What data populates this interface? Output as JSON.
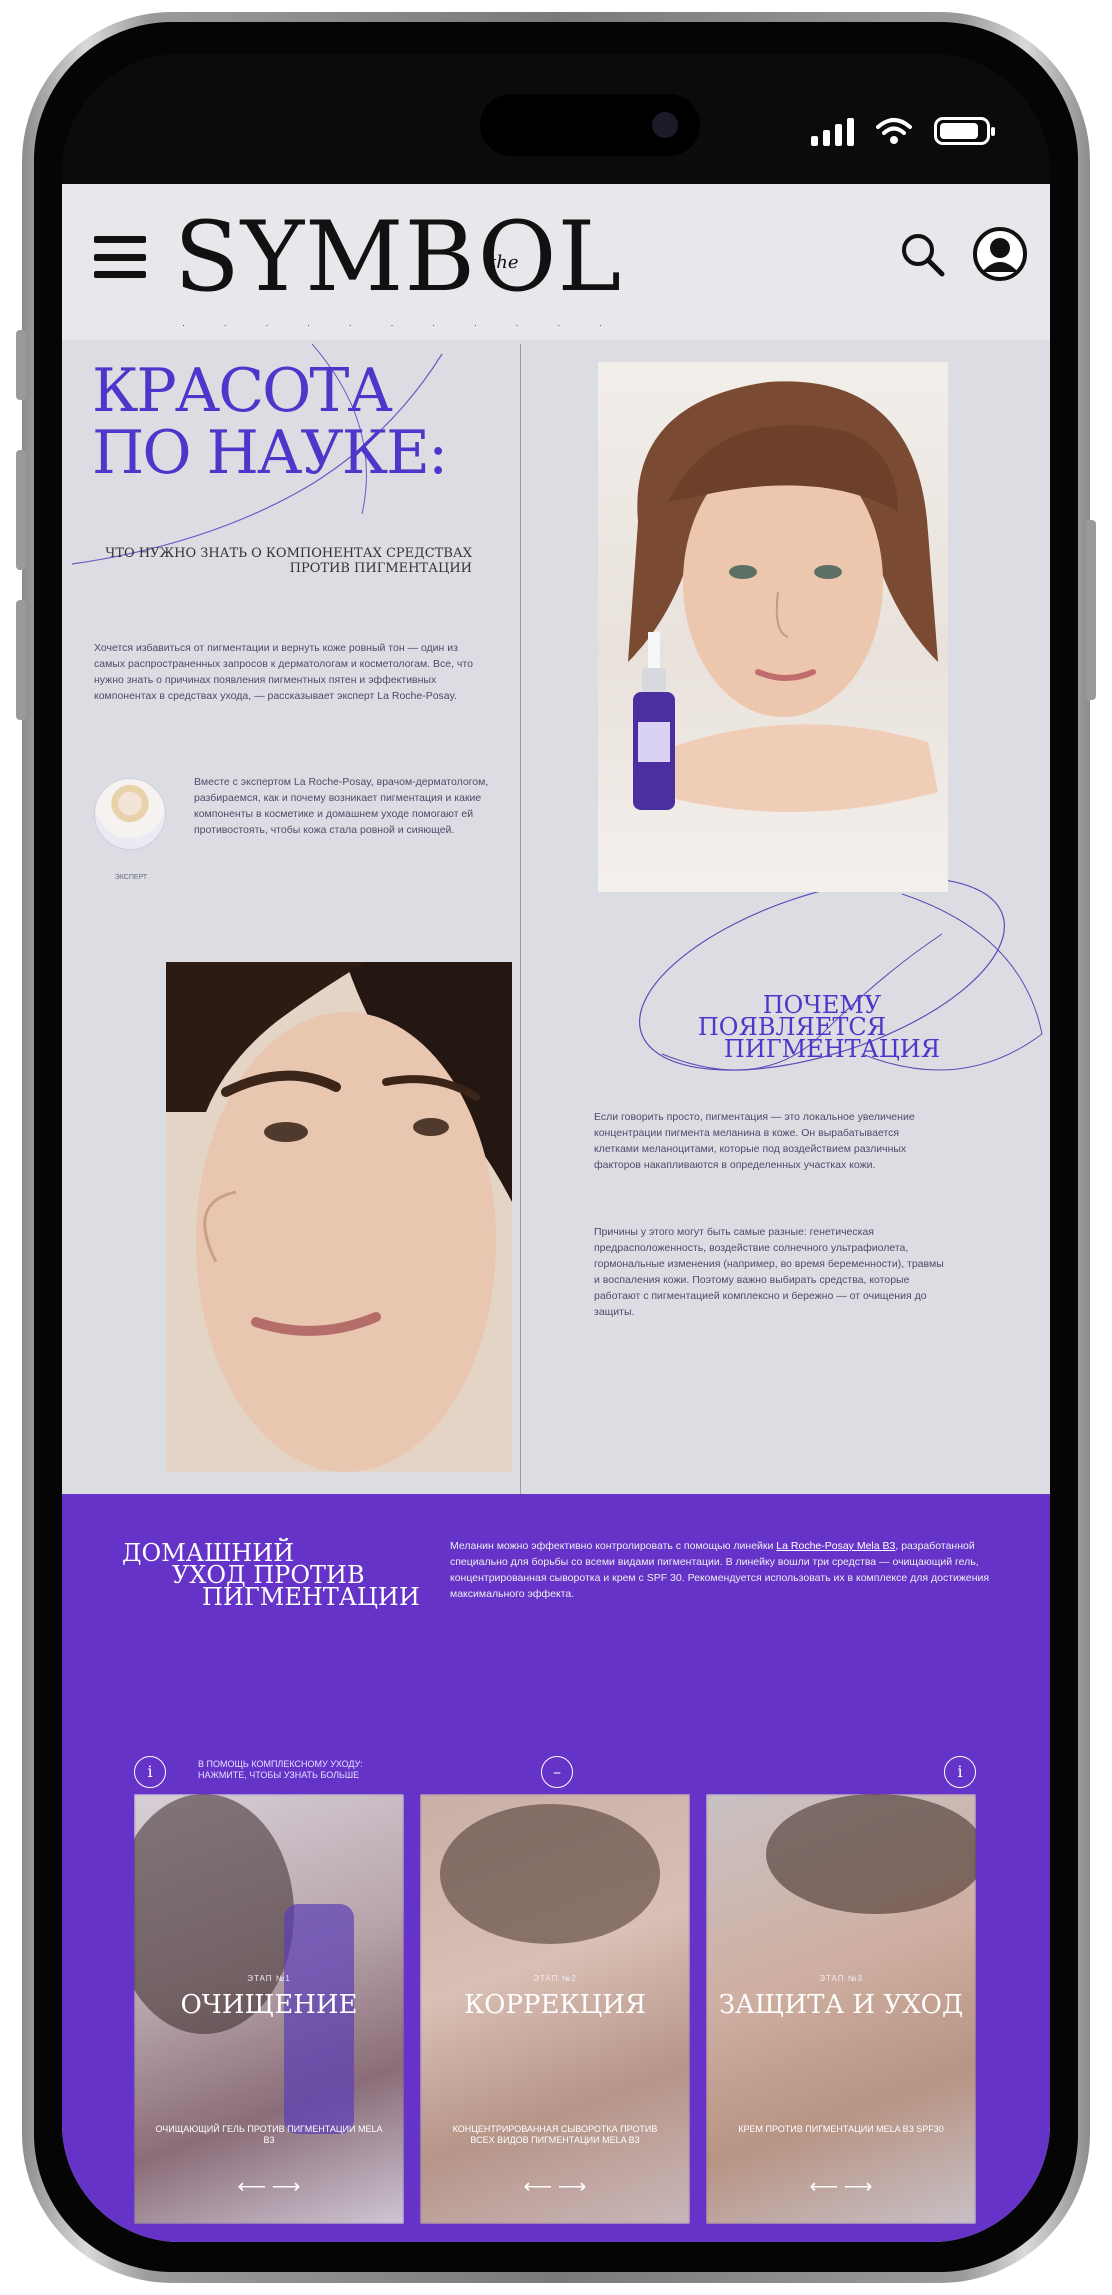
{
  "colors": {
    "accent": "#4f35c9",
    "purple_band": "#6533c8",
    "page_bg": "#dcdde2"
  },
  "header": {
    "logo_text": "SYMBOL",
    "logo_the": "the",
    "menu_icon": "hamburger-icon",
    "search_icon": "search-icon",
    "account_icon": "user-icon"
  },
  "article": {
    "title_line1": "КРАСОТА",
    "title_line2": "ПО НАУКЕ:",
    "subhead": "что нужно знать о компонентах средствах против пигментации",
    "lead": "Хочется избавиться от пигментации и вернуть коже ровный тон — один из самых распространенных запросов к дерматологам и косметологам. Все, что нужно знать о причинах появления пигментных пятен и эффективных компонентах в средствах ухода, — рассказывает эксперт La Roche-Posay.",
    "expert_text": "Вместе с экспертом La Roche-Posay, врачом-дерматологом, разбираемся, как и почему возникает пигментация и какие компоненты в косметике и домашнем уходе помогают ей противостоять, чтобы кожа стала ровной и сияющей.",
    "expert_caption": "ЭКСПЕРТ"
  },
  "pigment_section": {
    "heading_line1": "ПОЧЕМУ",
    "heading_line2": "ПОЯВЛЯЕТСЯ",
    "heading_line3": "ПИГМЕНТАЦИЯ",
    "body1": "Если говорить просто, пигментация — это локальное увеличение концентрации пигмента меланина в коже. Он вырабатывается клетками меланоцитами, которые под воздействием различных факторов накапливаются в определенных участках кожи.",
    "body2": "Причины у этого могут быть самые разные: генетическая предрасположенность, воздействие солнечного ультрафиолета, гормональные изменения (например, во время беременности), травмы и воспаления кожи. Поэтому важно выбирать средства, которые работают с пигментацией комплексно и бережно — от очищения до защиты."
  },
  "home_care": {
    "title_line1": "ДОМАШНИЙ",
    "title_line2": "УХОД ПРОТИВ",
    "title_line3": "ПИГМЕНТАЦИИ",
    "desc_before": "Меланин можно эффективно контролировать с помощью линейки ",
    "desc_brand": "La Roche-Posay Mela B3",
    "desc_after": ", разработанной специально для борьбы со всеми видами пигментации. В линейку вошли три средства — очищающий гель, концентрированная сыворотка и крем с SPF 30. Рекомендуется использовать их в комплексе для достижения максимального эффекта.",
    "info_note": "В ПОМОЩЬ КОМПЛЕКСНОМУ УХОДУ: НАЖМИТЕ, ЧТОБЫ УЗНАТЬ БОЛЬШЕ"
  },
  "cards": [
    {
      "stage": "ЭТАП №1",
      "name": "ОЧИЩЕНИЕ",
      "desc": "ОЧИЩАЮЩИЙ ГЕЛЬ ПРОТИВ ПИГМЕНТАЦИИ MELA B3",
      "arrows": "⟵  ⟶"
    },
    {
      "stage": "ЭТАП №2",
      "name": "КОРРЕКЦИЯ",
      "desc": "КОНЦЕНТРИРОВАННАЯ СЫВОРОТКА ПРОТИВ ВСЕХ ВИДОВ ПИГМЕНТАЦИИ MELA B3",
      "arrows": "⟵  ⟶"
    },
    {
      "stage": "ЭТАП №3",
      "name": "ЗАЩИТА И УХОД",
      "desc": "КРЕМ ПРОТИВ ПИГМЕНТАЦИИ MELA B3 SPF30",
      "arrows": "⟵  ⟶"
    }
  ]
}
